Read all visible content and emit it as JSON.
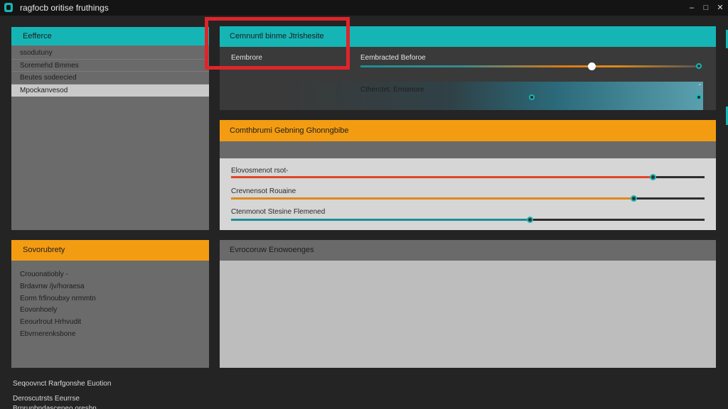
{
  "window": {
    "title": "ragfocb oritise fruthings",
    "minimize": "–",
    "maximize": "□",
    "close": "✕"
  },
  "left_panel": {
    "header": "Eefferce",
    "items": [
      {
        "label": "ssodutuny"
      },
      {
        "label": "Soremehd  Bmmes"
      },
      {
        "label": "Beutes  sodeecied"
      },
      {
        "label": "Mpockanvesod"
      }
    ]
  },
  "teal_panel": {
    "header": "Cemnuntl  binme  Jtrishesite",
    "field_label": "Eembrore",
    "slider_label": "Eembracted  Beforoe",
    "slider_value": 0.68,
    "gradient_label": "Ctherctet.  Ermimore"
  },
  "orange_panel": {
    "header": "Comthbrumi  Gebning Ghonngbibe",
    "sliders": [
      {
        "label": "Elovosmenot  rsot-",
        "value": 0.89,
        "color": "#e0452a"
      },
      {
        "label": "Crevnensot  Rouaine",
        "value": 0.85,
        "color": "#e08a1a"
      },
      {
        "label": "Ctenmonot  Stesine  Flemened",
        "value": 0.63,
        "color": "#1e8e96"
      }
    ]
  },
  "security_panel": {
    "header": "Sovorubrety",
    "items": [
      {
        "label": "Crouonatiobly  -"
      },
      {
        "label": "Brdavnw  /jv/horaesa"
      },
      {
        "label": "Eorm  frfinoubxy  nrmmtn"
      },
      {
        "label": "Eovonhoely"
      },
      {
        "label": "Eeourlrout  Hrhvudit"
      },
      {
        "label": "Ebvrnerenksbone"
      }
    ]
  },
  "bottom_right_panel": {
    "header": "Evrocoruw  Enowoenges"
  },
  "footer": {
    "line1": "Seqoovnct  Rarfgonshe  Euotion",
    "line2": "Deroscutrsts  Eeurrse",
    "line3": "Brnrunbndasceneo oresbn"
  },
  "colors": {
    "accent_teal": "#16b5b5",
    "accent_orange": "#f39c12",
    "highlight_red": "#e0242a"
  }
}
